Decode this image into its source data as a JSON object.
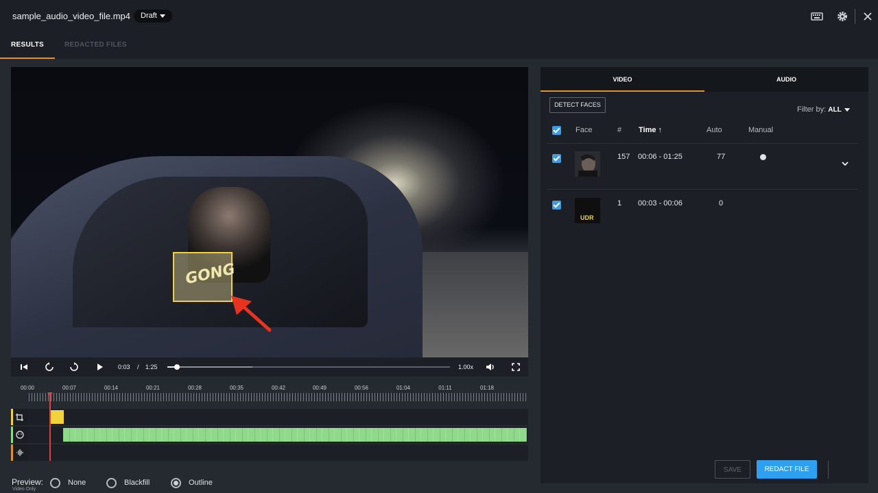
{
  "header": {
    "file_name": "sample_audio_video_file.mp4",
    "status": "Draft",
    "icons": [
      "keyboard-icon",
      "gear-icon",
      "close-icon"
    ]
  },
  "tabs": [
    {
      "label": "RESULTS",
      "active": true
    },
    {
      "label": "REDACTED FILES",
      "active": false
    }
  ],
  "player": {
    "current_time": "0:03",
    "separator": "/",
    "duration": "1:25",
    "speed": "1.00x",
    "progress_fraction": 0.035,
    "buffered_fraction": 0.3,
    "redaction_label": "GONG"
  },
  "timeline": {
    "ticks": [
      "00:00",
      "00:07",
      "00:14",
      "00:21",
      "00:28",
      "00:35",
      "00:42",
      "00:49",
      "00:56",
      "01:04",
      "01:11",
      "01:18"
    ],
    "track_colors": {
      "objects": "#f2d33b",
      "faces": "#8fd98a",
      "audio": "#e0922f"
    }
  },
  "preview": {
    "label": "Preview:",
    "sublabel": "Video Only",
    "options": [
      {
        "label": "None",
        "selected": false
      },
      {
        "label": "Blackfill",
        "selected": false
      },
      {
        "label": "Outline",
        "selected": true
      }
    ]
  },
  "panel": {
    "tabs": [
      {
        "label": "VIDEO",
        "active": true
      },
      {
        "label": "AUDIO",
        "active": false
      }
    ],
    "detect_button": "DETECT FACES",
    "filter_label": "Filter by:",
    "filter_value": "ALL",
    "columns": {
      "face": "Face",
      "count": "#",
      "time": "Time",
      "auto": "Auto",
      "manual": "Manual"
    },
    "rows": [
      {
        "count": "157",
        "time": "00:06 - 01:25",
        "auto": "77",
        "manual_marked": true,
        "checked": true
      },
      {
        "count": "1",
        "time": "00:03 - 00:06",
        "auto": "0",
        "manual_marked": false,
        "checked": true,
        "thumb_text": "UDR"
      }
    ],
    "save_button": "SAVE",
    "redact_button": "REDACT FILE"
  },
  "colors": {
    "accent": "#e0922f",
    "primary": "#2fa0f0",
    "redaction": "#f2d33b",
    "playhead": "#e04040"
  }
}
